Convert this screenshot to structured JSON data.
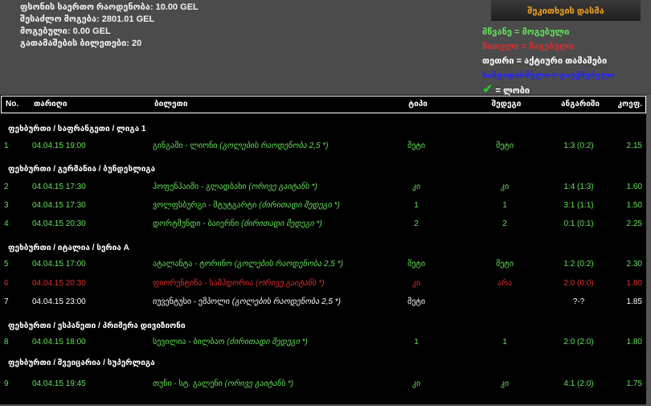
{
  "summary": {
    "total_stake": "ფსონის საერთო რაოდენობა: 10.00 GEL",
    "possible_win": "შესაძლო მოგება: 2801.01 GEL",
    "won": "მოგებული: 0.00 GEL",
    "tickets": "გათამაშების ბილეთები: 20"
  },
  "ask_button": "შეკითხვის დასმა",
  "legend": {
    "green": "მწვანე = მოგებული",
    "red": "წითელი = წაგებული",
    "white": "თეთრი = აქტიური თამაშები",
    "strike": "ხაზგადასმული = გაუქმებული",
    "check": "= ლობი"
  },
  "colors": {
    "win": "#66e05a",
    "loss": "#e03030",
    "active": "#ffffff",
    "cancelled": "#2a2ae0"
  },
  "headers": [
    "No.",
    "თარიღი",
    "ბილეთი",
    "ტიპი",
    "შედეგი",
    "ანგარიში",
    "კოეფ."
  ],
  "groups": [
    {
      "title": "ფეხბურთი / საფრანგეთი / ლიგა 1",
      "rows": [
        {
          "no": "1",
          "date": "04.04.15 19:00",
          "match": "გინგამი - ლიონი",
          "bet": "(გოლების რაოდენობა 2,5 *)",
          "type": "მეტი",
          "result": "მეტი",
          "score": "1:3 (0:2)",
          "odds": "2.15",
          "status": "green"
        }
      ]
    },
    {
      "title": "ფეხბურთი / გერმანია / ბუნდესლიგა",
      "rows": [
        {
          "no": "2",
          "date": "04.04.15 17:30",
          "match": "ჰოფენჰაიმი - გლადბახი",
          "bet": "(ორივე გაიტანს *)",
          "type": "კი",
          "result": "კი",
          "score": "1:4 (1:3)",
          "odds": "1.60",
          "status": "green"
        },
        {
          "no": "3",
          "date": "04.04.15 17:30",
          "match": "ვოლფსბურგი - შტუტგარტი",
          "bet": "(ძირითადი შედეგი *)",
          "type": "1",
          "result": "1",
          "score": "3:1 (1:1)",
          "odds": "1.50",
          "status": "green"
        },
        {
          "no": "4",
          "date": "04.04.15 20:30",
          "match": "დორტმუნდი - ბაიერნი",
          "bet": "(ძირითადი შედეგი *)",
          "type": "2",
          "result": "2",
          "score": "0:1 (0:1)",
          "odds": "2.25",
          "status": "green"
        }
      ]
    },
    {
      "title": "ფეხბურთი / იტალია / სერია A",
      "rows": [
        {
          "no": "5",
          "date": "04.04.15 17:00",
          "match": "ატალანტა - ტორინო",
          "bet": "(გოლების რაოდენობა 2,5 *)",
          "type": "მეტი",
          "result": "მეტი",
          "score": "1:2 (0:2)",
          "odds": "2.30",
          "status": "green"
        },
        {
          "no": "6",
          "date": "04.04.15 20:30",
          "match": "ფიორენტინა - სამპდორია",
          "bet": "(ორივე გაიტანს *)",
          "type": "კი",
          "result": "არა",
          "score": "2:0 (0:0)",
          "odds": "1.80",
          "status": "red"
        },
        {
          "no": "7",
          "date": "04.04.15 23:00",
          "match": "იუვენტუსი - ემპოლი",
          "bet": "(გოლების რაოდენობა 2,5 *)",
          "type": "მეტი",
          "result": "",
          "score": "?-?",
          "odds": "1.85",
          "status": "white"
        }
      ]
    },
    {
      "title": "ფეხბურთი / ესპანეთი / პრიმერა დივიზიონი",
      "rows": [
        {
          "no": "8",
          "date": "04.04.15 18:00",
          "match": "სევილია - ბილბაო",
          "bet": "(ძირითადი შედეგი *)",
          "type": "1",
          "result": "1",
          "score": "2:0 (2:0)",
          "odds": "1.80",
          "status": "green"
        }
      ]
    },
    {
      "title": "ფეხბურთი / შვეიცარია / სუპერლიგა",
      "rows": [
        {
          "no": "9",
          "date": "04.04.15 19:45",
          "match": "თუნი - სტ. გალენი",
          "bet": "(ორივე გაიტანს *)",
          "type": "კი",
          "result": "კი",
          "score": "4:1 (2:0)",
          "odds": "1.75",
          "status": "green"
        }
      ]
    }
  ]
}
